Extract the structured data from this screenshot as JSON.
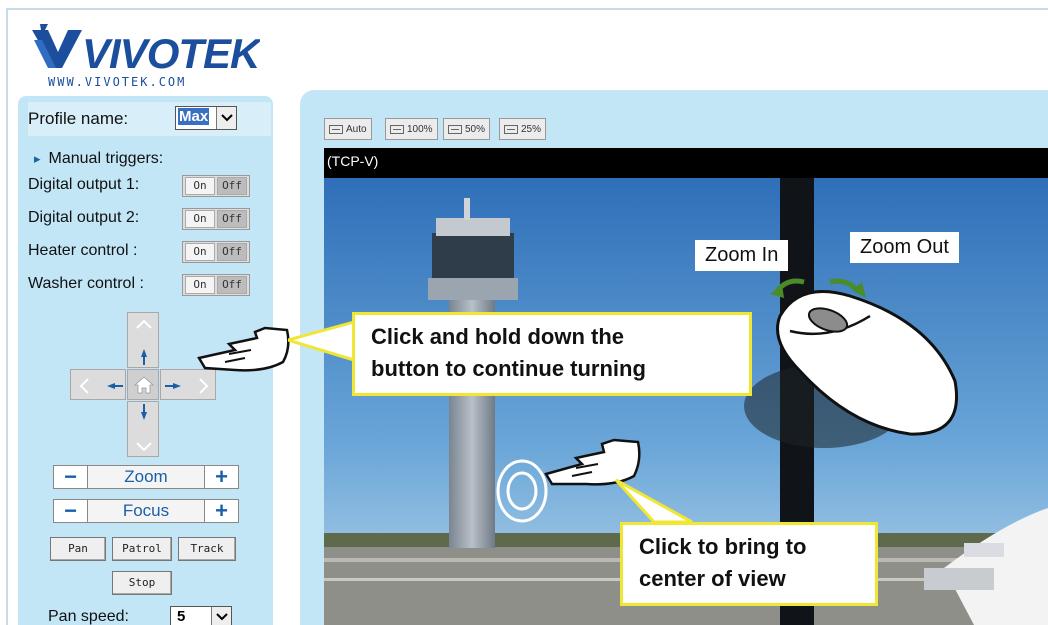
{
  "brand": {
    "name": "VIVOTEK",
    "url": "WWW.VIVOTEK.COM"
  },
  "profile": {
    "label": "Profile name:",
    "value": "Max"
  },
  "manual_triggers": {
    "title": "Manual triggers:",
    "rows": [
      {
        "label": "Digital output 1:",
        "on": "On",
        "off": "Off"
      },
      {
        "label": "Digital output 2:",
        "on": "On",
        "off": "Off"
      },
      {
        "label": "Heater control :",
        "on": "On",
        "off": "Off"
      },
      {
        "label": "Washer control :",
        "on": "On",
        "off": "Off"
      }
    ]
  },
  "ptz": {
    "zoom_label": "Zoom",
    "focus_label": "Focus",
    "minus": "−",
    "plus": "+",
    "buttons": [
      "Pan",
      "Patrol",
      "Track"
    ],
    "stop": "Stop",
    "pan_speed_label": "Pan speed:",
    "pan_speed_value": "5"
  },
  "view_sizes": [
    "Auto",
    "100%",
    "50%",
    "25%"
  ],
  "stream_label": "(TCP-V)",
  "annotations": {
    "zoom_in": "Zoom In",
    "zoom_out": "Zoom Out",
    "hold_line1": "Click and hold down the",
    "hold_line2": "button to continue turning",
    "center_line1": "Click to bring to",
    "center_line2": "center of view"
  },
  "colors": {
    "panel": "#c3e6f7",
    "callout_border": "#f1e633",
    "accent": "#1a5fa8"
  }
}
